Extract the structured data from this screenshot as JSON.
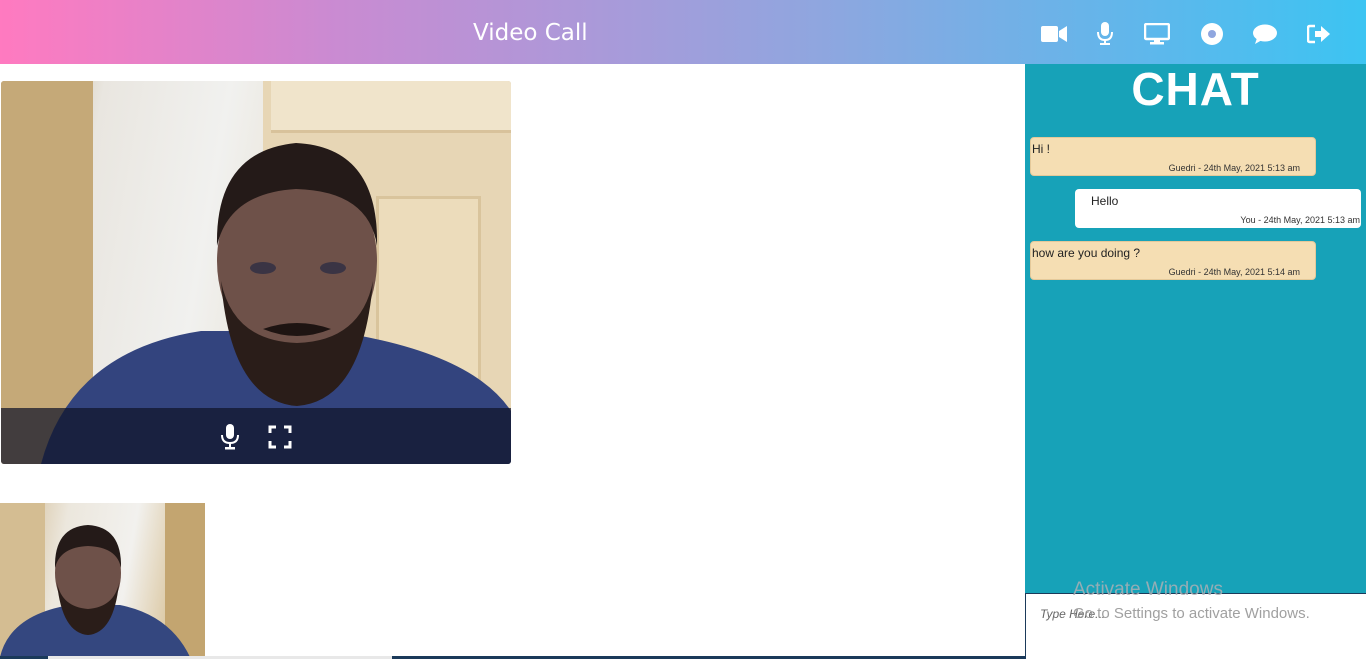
{
  "header": {
    "title": "Video Call",
    "tools": [
      {
        "name": "video-icon"
      },
      {
        "name": "microphone-icon"
      },
      {
        "name": "screen-share-icon"
      },
      {
        "name": "record-icon"
      },
      {
        "name": "chat-icon"
      },
      {
        "name": "leave-icon"
      }
    ]
  },
  "video": {
    "controls": [
      "microphone-icon",
      "fullscreen-icon"
    ]
  },
  "chat": {
    "title": "CHAT",
    "messages": [
      {
        "text": "Hi !",
        "meta": "Guedri - 24th May, 2021 5:13 am",
        "from": "other"
      },
      {
        "text": "Hello",
        "meta": "You - 24th May, 2021 5:13 am",
        "from": "mine"
      },
      {
        "text": "how are you doing ?",
        "meta": "Guedri - 24th May, 2021 5:14 am",
        "from": "other"
      }
    ],
    "input_placeholder": "Type Here..."
  },
  "watermark": {
    "line1": "Activate Windows",
    "line2": "Go to Settings to activate Windows."
  },
  "colors": {
    "chat_bg": "#17a2b8",
    "other_bubble": "#f5deb3",
    "mine_bubble": "#ffffff"
  }
}
